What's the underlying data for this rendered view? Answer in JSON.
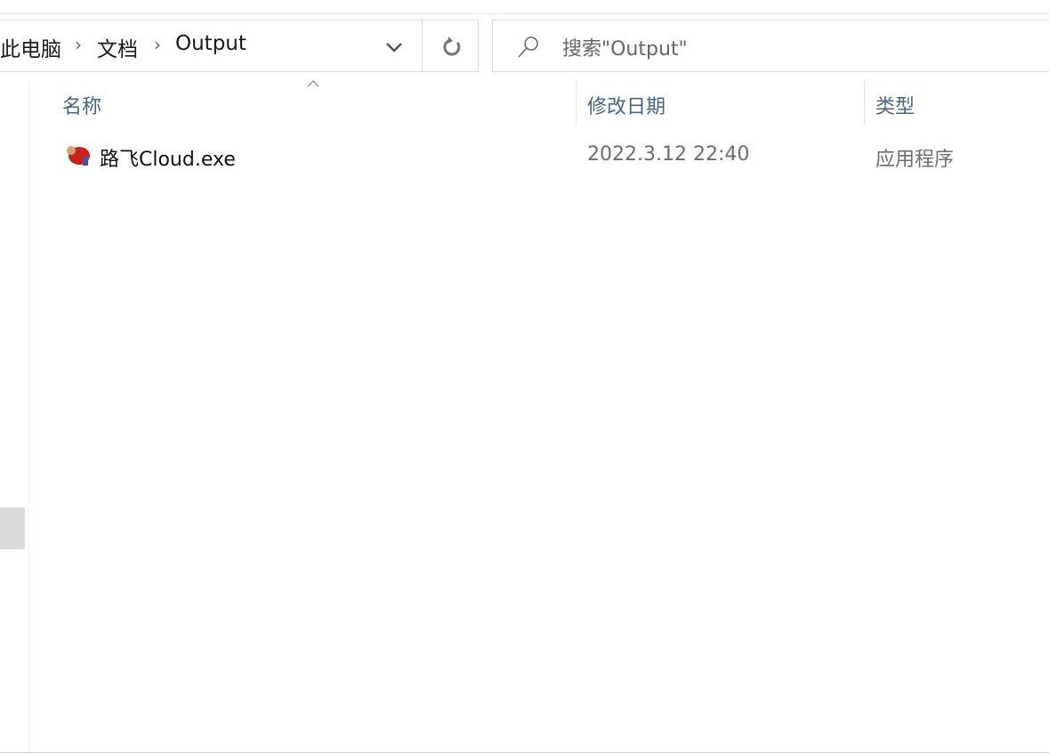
{
  "breadcrumb": {
    "items": [
      "此电脑",
      "文档",
      "Output"
    ]
  },
  "search": {
    "placeholder": "搜索\"Output\""
  },
  "columns": {
    "name": "名称",
    "date": "修改日期",
    "type": "类型"
  },
  "files": [
    {
      "name": "路飞Cloud.exe",
      "date": "2022.3.12 22:40",
      "type": "应用程序",
      "icon": "app-icon"
    }
  ]
}
